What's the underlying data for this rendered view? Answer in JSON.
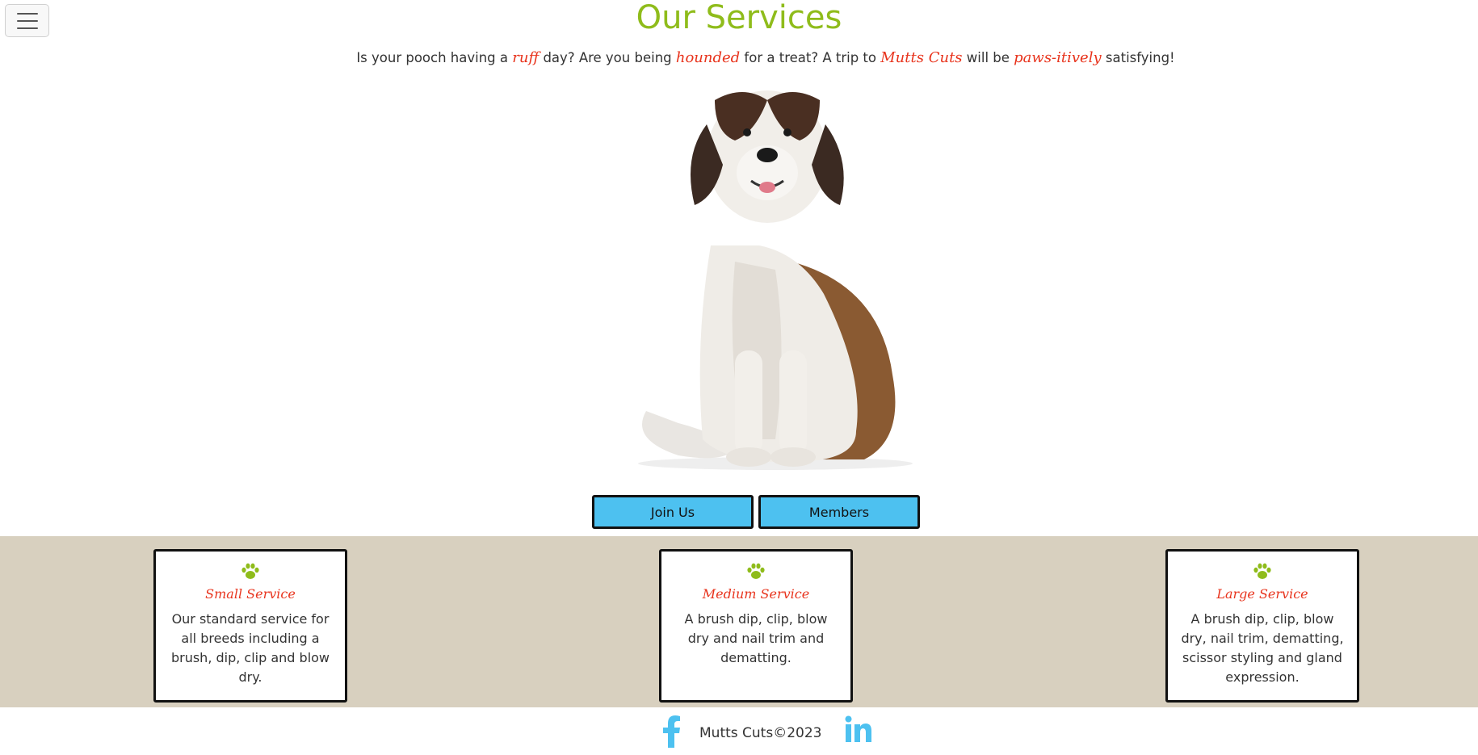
{
  "header": {
    "menu_icon": "hamburger-menu-icon",
    "title": "Our Services"
  },
  "tagline": {
    "part1": "Is your pooch having a ",
    "accent1": "ruff",
    "part2": " day? Are you being ",
    "accent2": "hounded",
    "part3": " for a treat? A trip to ",
    "accent3": "Mutts Cuts",
    "part4": " will be ",
    "accent4": "paws-itively",
    "part5": " satisfying!"
  },
  "hero": {
    "image": "st-bernard-dog-photo"
  },
  "buttons": {
    "join_label": "Join Us",
    "members_label": "Members"
  },
  "services": [
    {
      "icon": "paw-icon",
      "title": "Small Service",
      "text": "Our standard service for all breeds including a brush, dip, clip and blow dry."
    },
    {
      "icon": "paw-icon",
      "title": "Medium Service",
      "text": "A brush dip, clip, blow dry and nail trim and dematting."
    },
    {
      "icon": "paw-icon",
      "title": "Large Service",
      "text": "A brush dip, clip, blow dry, nail trim, dematting, scissor styling and gland expression."
    }
  ],
  "footer": {
    "facebook_icon": "facebook-icon",
    "copyright": "Mutts Cuts©2023",
    "linkedin_icon": "linkedin-icon"
  },
  "colors": {
    "title_green": "#8fbc1b",
    "accent_red": "#e8331c",
    "button_blue": "#4dc1f0",
    "band_beige": "#d8d0bf",
    "social_blue": "#4dc1f0"
  }
}
